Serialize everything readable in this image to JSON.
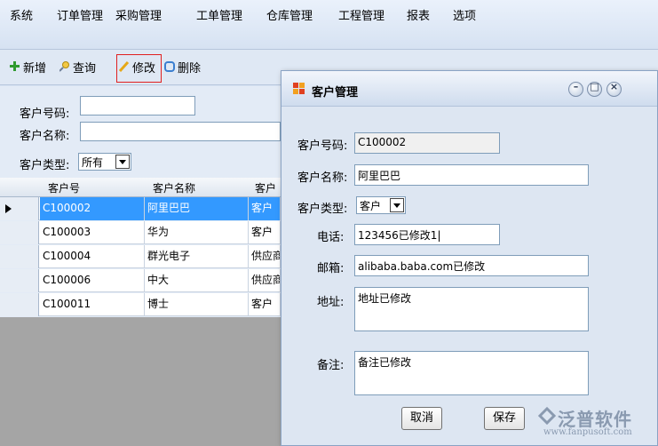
{
  "menu": [
    "系统",
    "订单管理",
    "采购管理",
    "工单管理",
    "仓库管理",
    "工程管理",
    "报表",
    "选项"
  ],
  "toolbar": {
    "new_label": "新增",
    "query_label": "查询",
    "edit_label": "修改",
    "delete_label": "删除"
  },
  "search": {
    "code_label": "客户号码:",
    "code_value": "",
    "name_label": "客户名称:",
    "name_value": "",
    "type_label": "客户类型:",
    "type_value": "所有"
  },
  "grid": {
    "columns": [
      "客户号",
      "客户名称",
      "客户"
    ],
    "rows": [
      {
        "code": "C100002",
        "name": "阿里巴巴",
        "type": "客户",
        "selected": true
      },
      {
        "code": "C100003",
        "name": "华为",
        "type": "客户",
        "selected": false
      },
      {
        "code": "C100004",
        "name": "群光电子",
        "type": "供应商",
        "selected": false
      },
      {
        "code": "C100006",
        "name": "中大",
        "type": "供应商",
        "selected": false
      },
      {
        "code": "C100011",
        "name": "博士",
        "type": "客户",
        "selected": false
      }
    ]
  },
  "dialog": {
    "title": "客户管理",
    "code_label": "客户号码:",
    "code_value": "C100002",
    "name_label": "客户名称:",
    "name_value": "阿里巴巴",
    "type_label": "客户类型:",
    "type_value": "客户",
    "phone_label": "电话:",
    "phone_value": "123456已修改1|",
    "email_label": "邮箱:",
    "email_value": "alibaba.baba.com已修改",
    "address_label": "地址:",
    "address_value": "地址已修改",
    "note_label": "备注:",
    "note_value": "备注已修改",
    "cancel_label": "取消",
    "save_label": "保存"
  },
  "brand": {
    "name": "泛普软件",
    "url": "www.fanpusoft.com"
  }
}
